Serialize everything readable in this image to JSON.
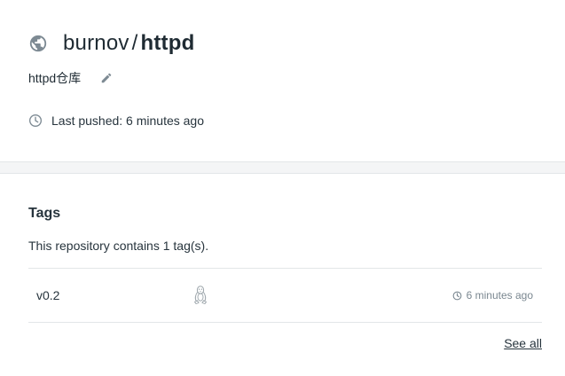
{
  "repo": {
    "namespace": "burnov",
    "separator": "/",
    "name": "httpd",
    "description": "httpd仓库",
    "last_pushed": "Last pushed: 6 minutes ago"
  },
  "tags": {
    "heading": "Tags",
    "summary": "This repository contains 1 tag(s).",
    "rows": [
      {
        "name": "v0.2",
        "os_icon": "linux-icon",
        "pushed": "6 minutes ago"
      }
    ],
    "see_all": "See all"
  },
  "icons": {
    "visibility": "globe-icon",
    "edit": "pencil-icon",
    "time": "clock-icon"
  },
  "colors": {
    "text": "#27343d",
    "muted": "#7a8790",
    "icon": "#7d8a93",
    "band": "#f4f5f6",
    "border": "#e3e6e8"
  }
}
